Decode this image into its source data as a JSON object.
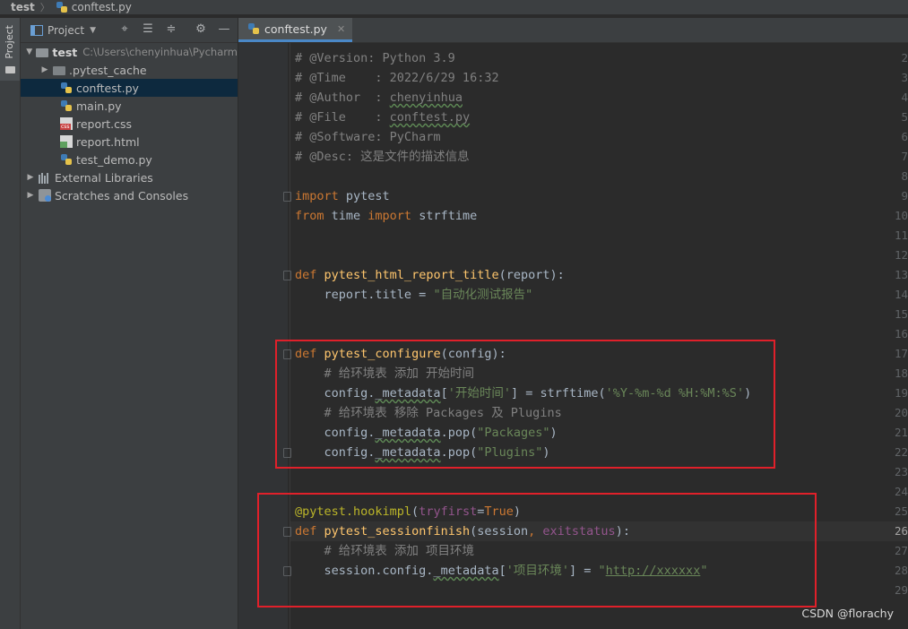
{
  "breadcrumb": {
    "root": "test",
    "file": "conftest.py"
  },
  "toolstrip": {
    "project_label": "Project"
  },
  "project_panel": {
    "view_label": "Project",
    "header_buttons": [
      "crosshair-icon",
      "collapse-all-icon",
      "expand-all-icon",
      "gear-icon",
      "hide-icon"
    ],
    "tree": [
      {
        "label": "test",
        "path": "C:\\Users\\chenyinhua\\Pycharm",
        "icon": "folder",
        "expanded": true,
        "depth": 0
      },
      {
        "label": ".pytest_cache",
        "icon": "folder",
        "expanded": false,
        "depth": 1
      },
      {
        "label": "conftest.py",
        "icon": "python-file",
        "depth": 1,
        "selected": true
      },
      {
        "label": "main.py",
        "icon": "python-file",
        "depth": 1
      },
      {
        "label": "report.css",
        "icon": "css-file",
        "depth": 1
      },
      {
        "label": "report.html",
        "icon": "html-file",
        "depth": 1
      },
      {
        "label": "test_demo.py",
        "icon": "python-file",
        "depth": 1
      },
      {
        "label": "External Libraries",
        "icon": "library",
        "expanded": false,
        "depth": 0
      },
      {
        "label": "Scratches and Consoles",
        "icon": "scratch",
        "expanded": false,
        "depth": 0
      }
    ]
  },
  "editor": {
    "tab_label": "conftest.py",
    "current_line": 26,
    "lines": [
      {
        "n": 2,
        "text": "# @Version: Python 3.9"
      },
      {
        "n": 3,
        "text": "# @Time    : 2022/6/29 16:32"
      },
      {
        "n": 4,
        "text": "# @Author  : chenyinhua"
      },
      {
        "n": 5,
        "text": "# @File    : conftest.py"
      },
      {
        "n": 6,
        "text": "# @Software: PyCharm"
      },
      {
        "n": 7,
        "text": "# @Desc: 这是文件的描述信息"
      },
      {
        "n": 8,
        "text": ""
      },
      {
        "n": 9,
        "text": "import pytest"
      },
      {
        "n": 10,
        "text": "from time import strftime"
      },
      {
        "n": 11,
        "text": ""
      },
      {
        "n": 12,
        "text": ""
      },
      {
        "n": 13,
        "text": "def pytest_html_report_title(report):"
      },
      {
        "n": 14,
        "text": "    report.title = \"自动化测试报告\""
      },
      {
        "n": 15,
        "text": ""
      },
      {
        "n": 16,
        "text": ""
      },
      {
        "n": 17,
        "text": "def pytest_configure(config):"
      },
      {
        "n": 18,
        "text": "    # 给环境表 添加 开始时间"
      },
      {
        "n": 19,
        "text": "    config._metadata['开始时间'] = strftime('%Y-%m-%d %H:%M:%S')"
      },
      {
        "n": 20,
        "text": "    # 给环境表 移除 Packages 及 Plugins"
      },
      {
        "n": 21,
        "text": "    config._metadata.pop(\"Packages\")"
      },
      {
        "n": 22,
        "text": "    config._metadata.pop(\"Plugins\")"
      },
      {
        "n": 23,
        "text": ""
      },
      {
        "n": 24,
        "text": ""
      },
      {
        "n": 25,
        "text": "@pytest.hookimpl(tryfirst=True)"
      },
      {
        "n": 26,
        "text": "def pytest_sessionfinish(session, exitstatus):"
      },
      {
        "n": 27,
        "text": "    # 给环境表 添加 项目环境"
      },
      {
        "n": 28,
        "text": "    session.config._metadata['项目环境'] = \"http://xxxxxx\""
      },
      {
        "n": 29,
        "text": ""
      }
    ]
  },
  "colors": {
    "keyword": "#cc7832",
    "function": "#ffc66d",
    "comment": "#808080",
    "string": "#6a8759",
    "decorator": "#bbb529",
    "param": "#94558d",
    "text": "#a9b7c6",
    "highlight_box": "#e0202a"
  },
  "watermark": "CSDN @florachy"
}
